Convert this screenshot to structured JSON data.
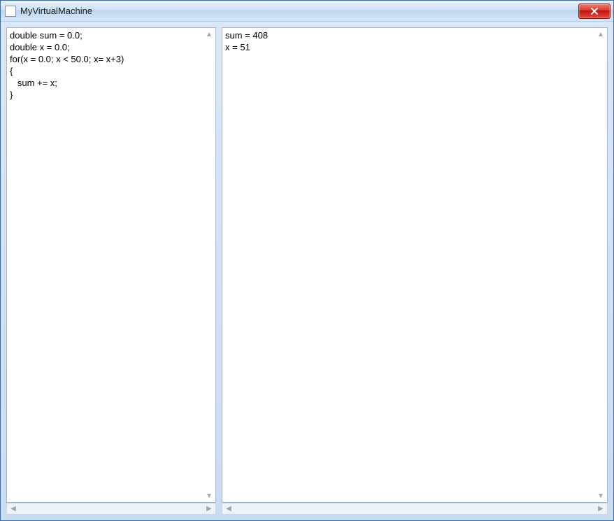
{
  "window": {
    "title": "MyVirtualMachine"
  },
  "editor": {
    "code": "double sum = 0.0;\ndouble x = 0.0;\nfor(x = 0.0; x < 50.0; x= x+3)\n{\n   sum += x;\n}"
  },
  "output": {
    "text": "sum = 408\nx = 51"
  }
}
